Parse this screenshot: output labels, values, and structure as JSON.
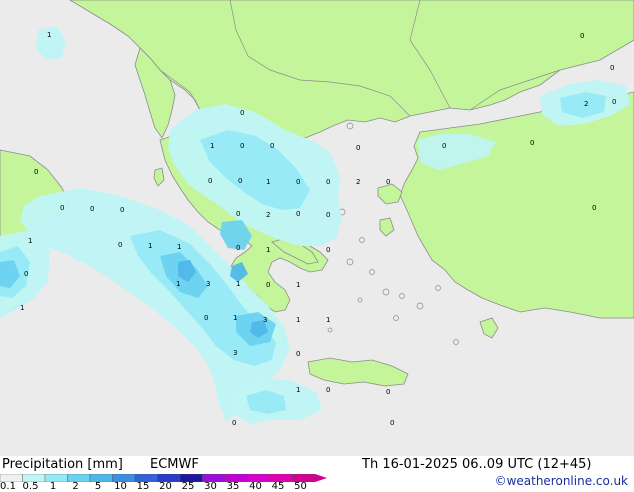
{
  "footer": {
    "title": "Precipitation [mm]",
    "model": "ECMWF",
    "datetime": "Th 16-01-2025 06..09 UTC (12+45)",
    "copyright": "©weatheronline.co.uk"
  },
  "legend": {
    "ticks": [
      "0.1",
      "0.5",
      "1",
      "2",
      "5",
      "10",
      "15",
      "20",
      "25",
      "30",
      "35",
      "40",
      "45",
      "50"
    ],
    "colors": [
      "#f0f0f0",
      "#bff5f5",
      "#95e9f5",
      "#6cd2ef",
      "#4fb8ea",
      "#3a8fe0",
      "#3263d8",
      "#2a3cc8",
      "#1a1a9a",
      "#9a10d8",
      "#c000d0",
      "#d800c8",
      "#e000b0",
      "#d00090"
    ]
  },
  "colors": {
    "sea": "#ebebeb",
    "land": "#c4f59a",
    "coast": "#8c8c8c",
    "precip_light": "#bff5f5",
    "precip_medium": "#95e9f5",
    "precip_heavy": "#6cd2ef",
    "precip_strong": "#4fb8ea"
  },
  "map_values": [
    {
      "label": "1"
    },
    {
      "label": "0"
    },
    {
      "label": "0"
    },
    {
      "label": "2"
    },
    {
      "label": "0"
    },
    {
      "label": "0"
    },
    {
      "label": "0"
    },
    {
      "label": "1"
    },
    {
      "label": "0"
    },
    {
      "label": "0"
    },
    {
      "label": "0"
    },
    {
      "label": "0"
    },
    {
      "label": "0"
    },
    {
      "label": "0"
    },
    {
      "label": "0"
    },
    {
      "label": "1"
    },
    {
      "label": "0"
    },
    {
      "label": "0"
    },
    {
      "label": "2"
    },
    {
      "label": "0"
    },
    {
      "label": "0"
    },
    {
      "label": "0"
    },
    {
      "label": "0"
    },
    {
      "label": "0"
    },
    {
      "label": "0"
    },
    {
      "label": "2"
    },
    {
      "label": "0"
    },
    {
      "label": "0"
    },
    {
      "label": "2"
    },
    {
      "label": "1"
    },
    {
      "label": "0"
    },
    {
      "label": "1"
    },
    {
      "label": "1"
    },
    {
      "label": "0"
    },
    {
      "label": "1"
    },
    {
      "label": "0"
    },
    {
      "label": "0"
    },
    {
      "label": "1"
    },
    {
      "label": "3"
    },
    {
      "label": "1"
    },
    {
      "label": "0"
    },
    {
      "label": "1"
    },
    {
      "label": "1"
    },
    {
      "label": "0"
    },
    {
      "label": "1"
    },
    {
      "label": "3"
    },
    {
      "label": "3"
    },
    {
      "label": "1"
    },
    {
      "label": "1"
    },
    {
      "label": "3"
    },
    {
      "label": "0"
    },
    {
      "label": "1"
    },
    {
      "label": "0"
    },
    {
      "label": "0"
    },
    {
      "label": "0"
    },
    {
      "label": "0"
    }
  ]
}
